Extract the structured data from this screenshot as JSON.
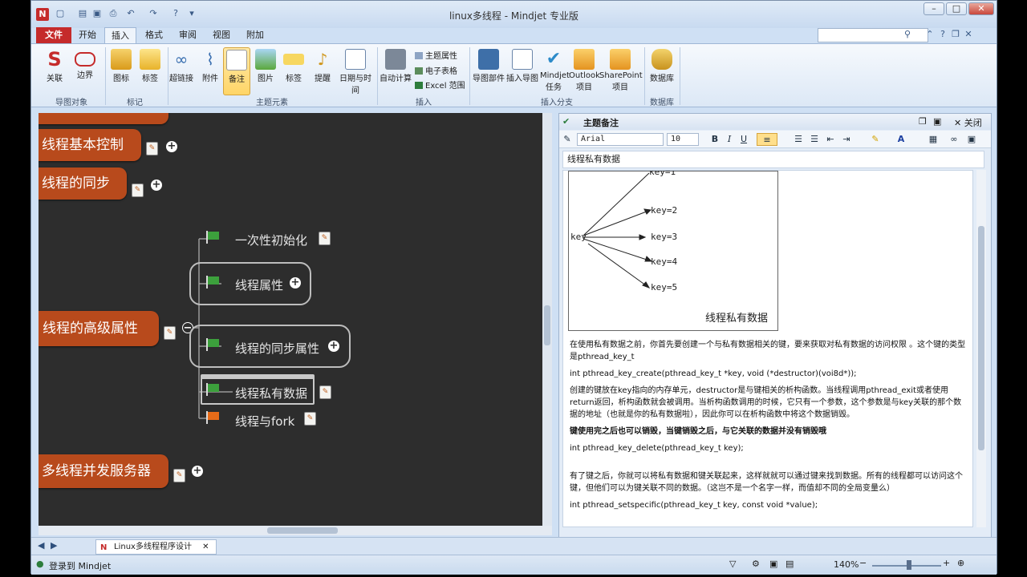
{
  "window": {
    "title": "linux多线程 - Mindjet 专业版",
    "app_logo": "N"
  },
  "tabs": {
    "file": "文件",
    "home": "开始",
    "insert": "插入",
    "format": "格式",
    "review": "审阅",
    "view": "视图",
    "addins": "附加"
  },
  "search": {
    "label": "查找",
    "value": ""
  },
  "ribbon": {
    "link": "关联",
    "boundary": "边界",
    "icon": "图标",
    "tag": "标签",
    "hyperlink": "超链接",
    "attachment": "附件",
    "notes": "备注",
    "picture": "图片",
    "label": "标签",
    "alert": "提醒",
    "datetime": "日期与时间",
    "autocalc": "自动计算",
    "topic_props": "主题属性",
    "spreadsheet": "电子表格",
    "excel_range": "Excel 范围",
    "map_part": "导图部件",
    "insert_map": "插入导图",
    "mindjet_tasks_1": "Mindjet",
    "mindjet_tasks_2": "任务",
    "outlook_1": "Outlook",
    "outlook_2": "项目",
    "sharepoint_1": "SharePoint",
    "sharepoint_2": "项目",
    "database_1": "数据库",
    "database_2": "数据库",
    "grp_map_objects": "导图对象",
    "grp_marker": "标记",
    "grp_topic_elements": "主题元素",
    "grp_insert": "插入",
    "grp_insert_branch": "插入分支"
  },
  "map": {
    "topics": [
      "线程基本控制",
      "线程的同步",
      "线程的高级属性",
      "多线程并发服务器"
    ],
    "subtopics": [
      "一次性初始化",
      "线程属性",
      "线程的同步属性",
      "线程私有数据",
      "线程与fork"
    ]
  },
  "notes_pane": {
    "title": "主题备注",
    "close": "关闭",
    "font": "Arial",
    "size": "10",
    "topic_title": "线程私有数据",
    "diagram": {
      "key": "key",
      "k1": "key=1",
      "k2": "key=2",
      "k3": "key=3",
      "k4": "key=4",
      "k5": "key=5",
      "caption": "线程私有数据"
    },
    "p1": "在使用私有数据之前，你首先要创建一个与私有数据相关的键，要来获取对私有数据的访问权限 。这个键的类型是pthread_key_t",
    "p2": "int pthread_key_create(pthread_key_t *key, void (*destructor)(voi8d*));",
    "p3": "创建的键放在key指向的内存单元，destructor是与键相关的析构函数。当线程调用pthread_exit或者使用return返回，析构函数就会被调用。当析构函数调用的时候，它只有一个参数，这个参数是与key关联的那个数据的地址（也就是你的私有数据啦），因此你可以在析构函数中将这个数据销毁。",
    "p4a": "键使用完之后也可以销毁，",
    "p4b": "当键销毁之后，与它关联的数据并没有销毁哦",
    "p5": "int pthread_key_delete(pthread_key_t key);",
    "p6": "有了键之后，你就可以将私有数据和键关联起来，这样就就可以通过键来找到数据。所有的线程都可以访问这个键，但他们可以为键关联不同的数据。（这岂不是一个名字一样，而值却不同的全局变量么）",
    "p7": " int pthread_setspecific(pthread_key_t key, const void *value);"
  },
  "doc_tab": "Linux多线程程序设计",
  "status": {
    "login": "登录到 Mindjet",
    "zoom": "140%"
  }
}
